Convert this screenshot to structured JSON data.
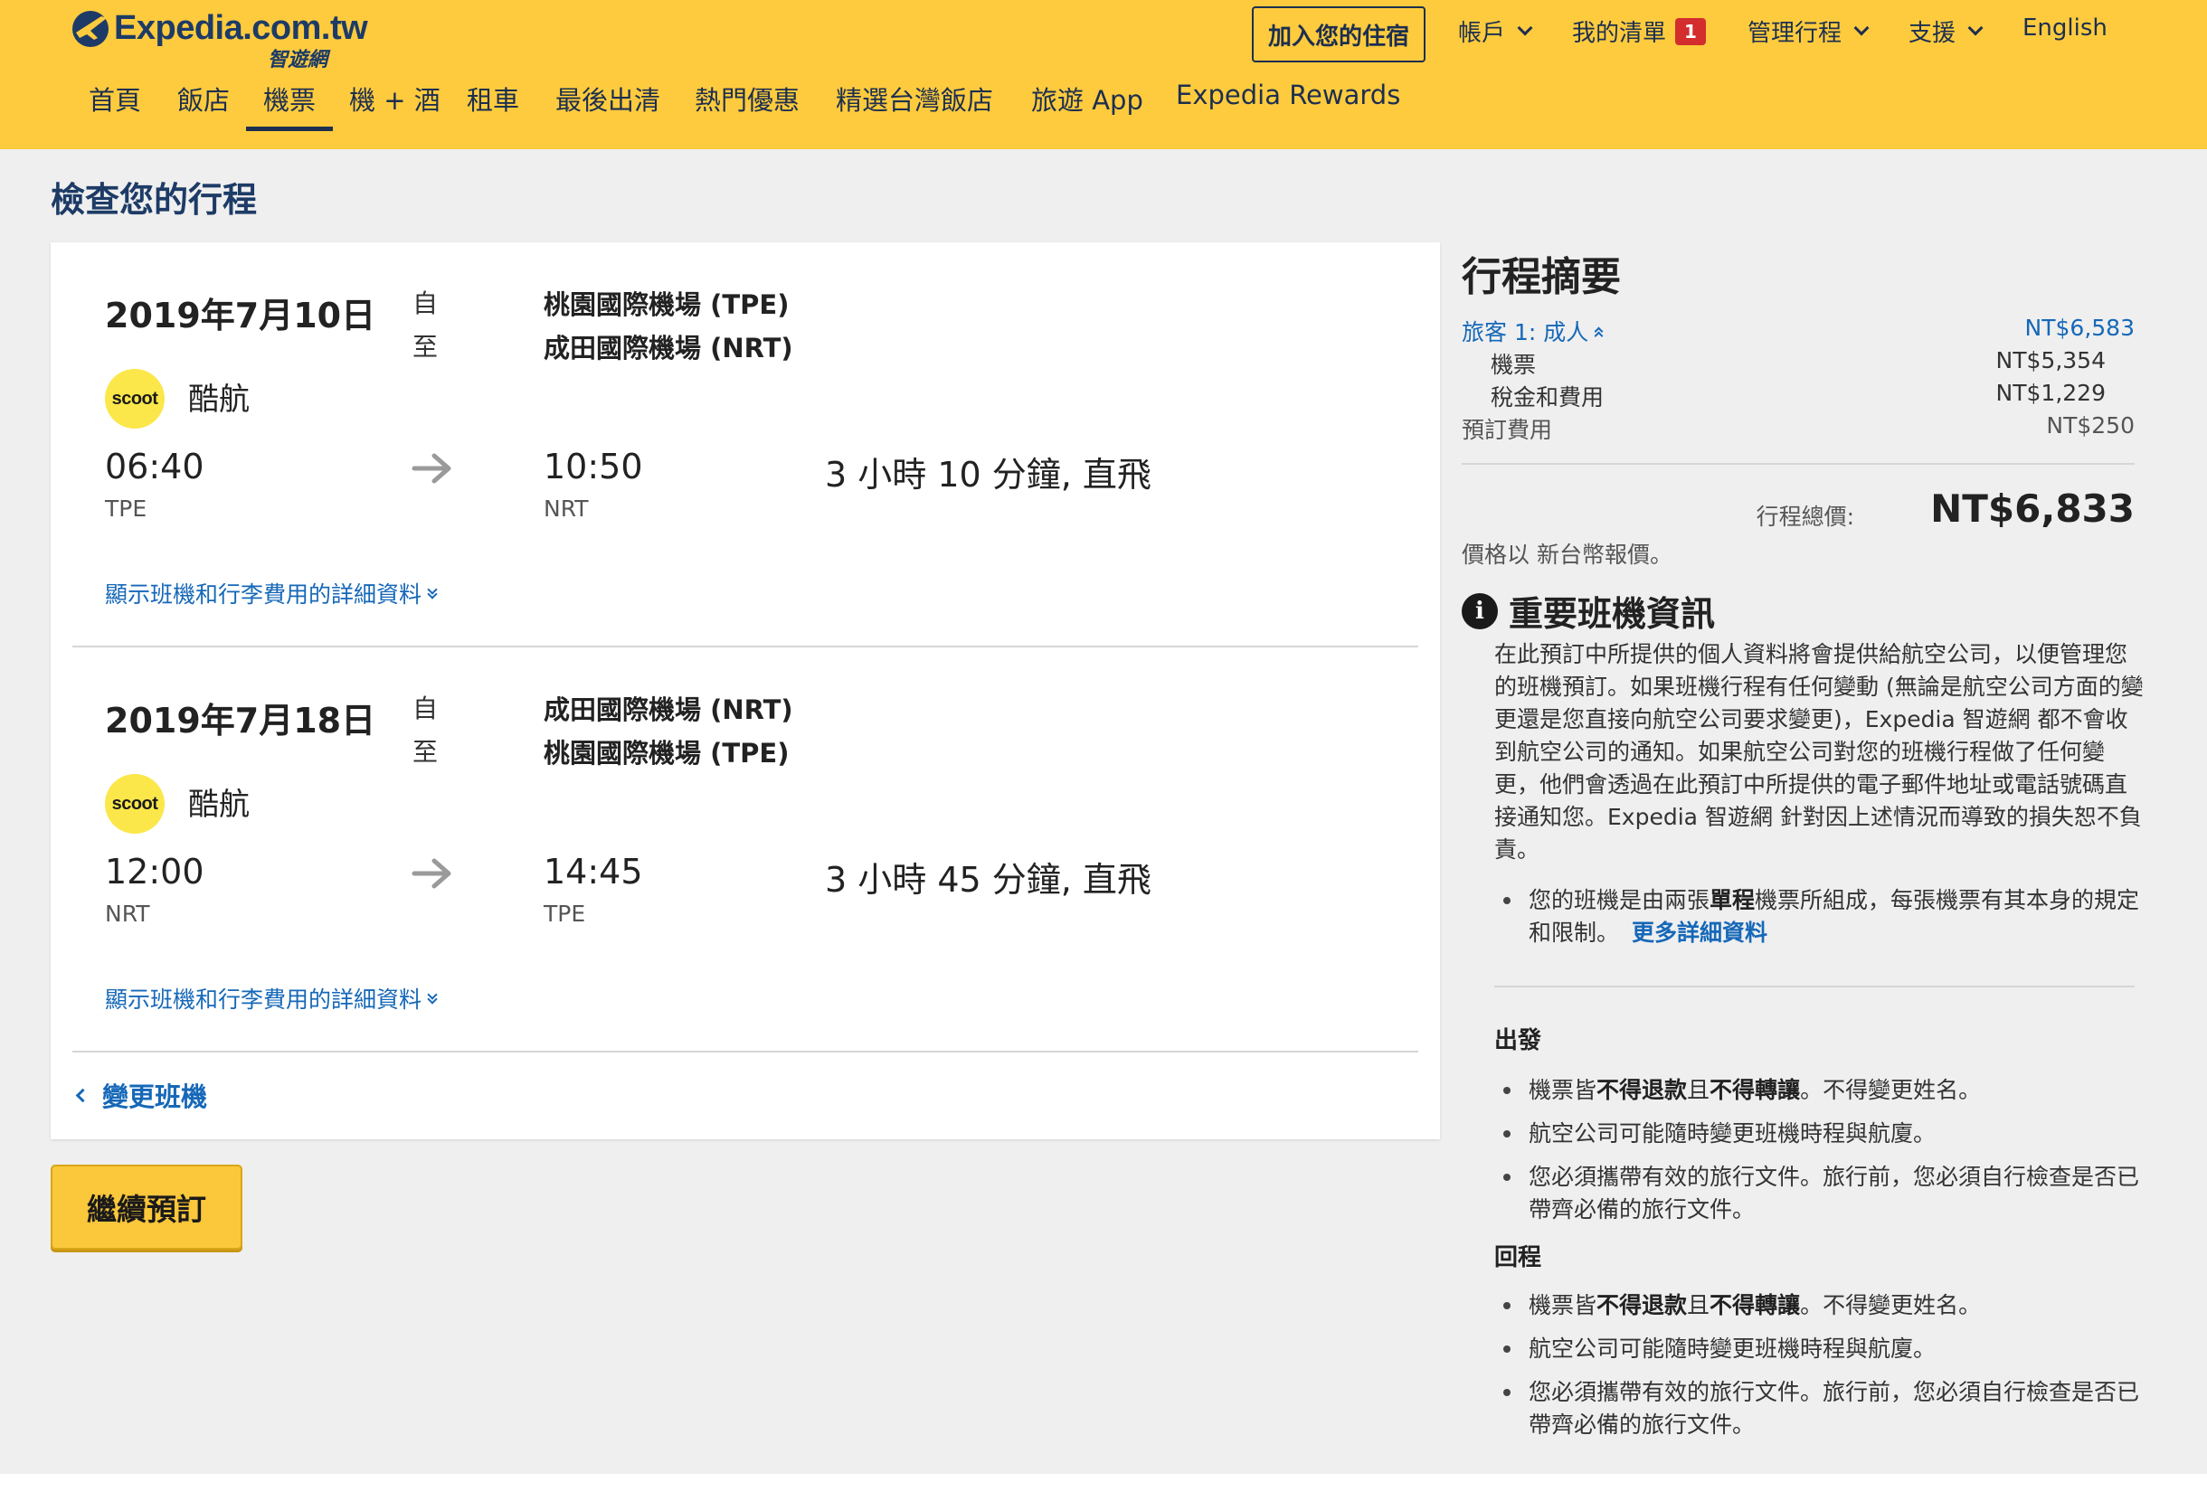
{
  "header": {
    "logo_text": "Expedia.com.tw",
    "logo_sub": "智遊網",
    "join_button": "加入您的住宿",
    "top_links": {
      "account": "帳戶",
      "list": "我的清單",
      "list_count": "1",
      "manage": "管理行程",
      "support": "支援",
      "language": "English"
    },
    "main_nav": [
      "首頁",
      "飯店",
      "機票",
      "機 + 酒",
      "租車",
      "最後出清",
      "熱門優惠",
      "精選台灣飯店",
      "旅遊 App",
      "Expedia Rewards"
    ],
    "active_nav": "機票"
  },
  "page_title": "檢查您的行程",
  "legs": [
    {
      "date": "2019年7月10日",
      "from_label": "自",
      "to_label": "至",
      "from_airport": "桃園國際機場 (TPE)",
      "to_airport": "成田國際機場 (NRT)",
      "airline_logo": "scoot",
      "airline": "酷航",
      "dep_time": "06:40",
      "dep_code": "TPE",
      "arr_time": "10:50",
      "arr_code": "NRT",
      "duration": "3 小時 10 分鐘, 直飛",
      "details_link": "顯示班機和行李費用的詳細資料"
    },
    {
      "date": "2019年7月18日",
      "from_label": "自",
      "to_label": "至",
      "from_airport": "成田國際機場 (NRT)",
      "to_airport": "桃園國際機場 (TPE)",
      "airline_logo": "scoot",
      "airline": "酷航",
      "dep_time": "12:00",
      "dep_code": "NRT",
      "arr_time": "14:45",
      "arr_code": "TPE",
      "duration": "3 小時 45 分鐘, 直飛",
      "details_link": "顯示班機和行李費用的詳細資料"
    }
  ],
  "change_flight": "變更班機",
  "continue_button": "繼續預訂",
  "summary": {
    "title": "行程摘要",
    "traveler": "旅客 1: 成人",
    "traveler_price": "NT$6,583",
    "ticket_label": "機票",
    "ticket_price": "NT$5,354",
    "tax_label": "稅金和費用",
    "tax_price": "NT$1,229",
    "booking_fee_label": "預訂費用",
    "booking_fee": "NT$250",
    "total_label": "行程總價:",
    "total_value": "NT$6,833",
    "currency_note": "價格以 新台幣報價。"
  },
  "important": {
    "title": "重要班機資訊",
    "paragraph": "在此預訂中所提供的個人資料將會提供給航空公司，以便管理您的班機預訂。如果班機行程有任何變動 (無論是航空公司方面的變更還是您直接向航空公司要求變更)，Expedia 智遊網 都不會收到航空公司的通知。如果航空公司對您的班機行程做了任何變更，他們會透過在此預訂中所提供的電子郵件地址或電話號碼直接通知您。Expedia 智遊網 針對因上述情況而導致的損失恕不負責。",
    "ticket_note_a": "您的班機是由兩張",
    "ticket_note_bold": "單程",
    "ticket_note_b": "機票所組成，每張機票有其本身的規定和限制。",
    "more_link": "更多詳細資料"
  },
  "rules": {
    "departure_head": "出發",
    "return_head": "回程",
    "r1_a": "機票皆",
    "r1_b1": "不得退款",
    "r1_c": "且",
    "r1_b2": "不得轉讓",
    "r1_d": "。不得變更姓名。",
    "r2": "航空公司可能隨時變更班機時程與航廈。",
    "r3": "您必須攜帶有效的旅行文件。旅行前，您必須自行檢查是否已帶齊必備的旅行文件。"
  }
}
